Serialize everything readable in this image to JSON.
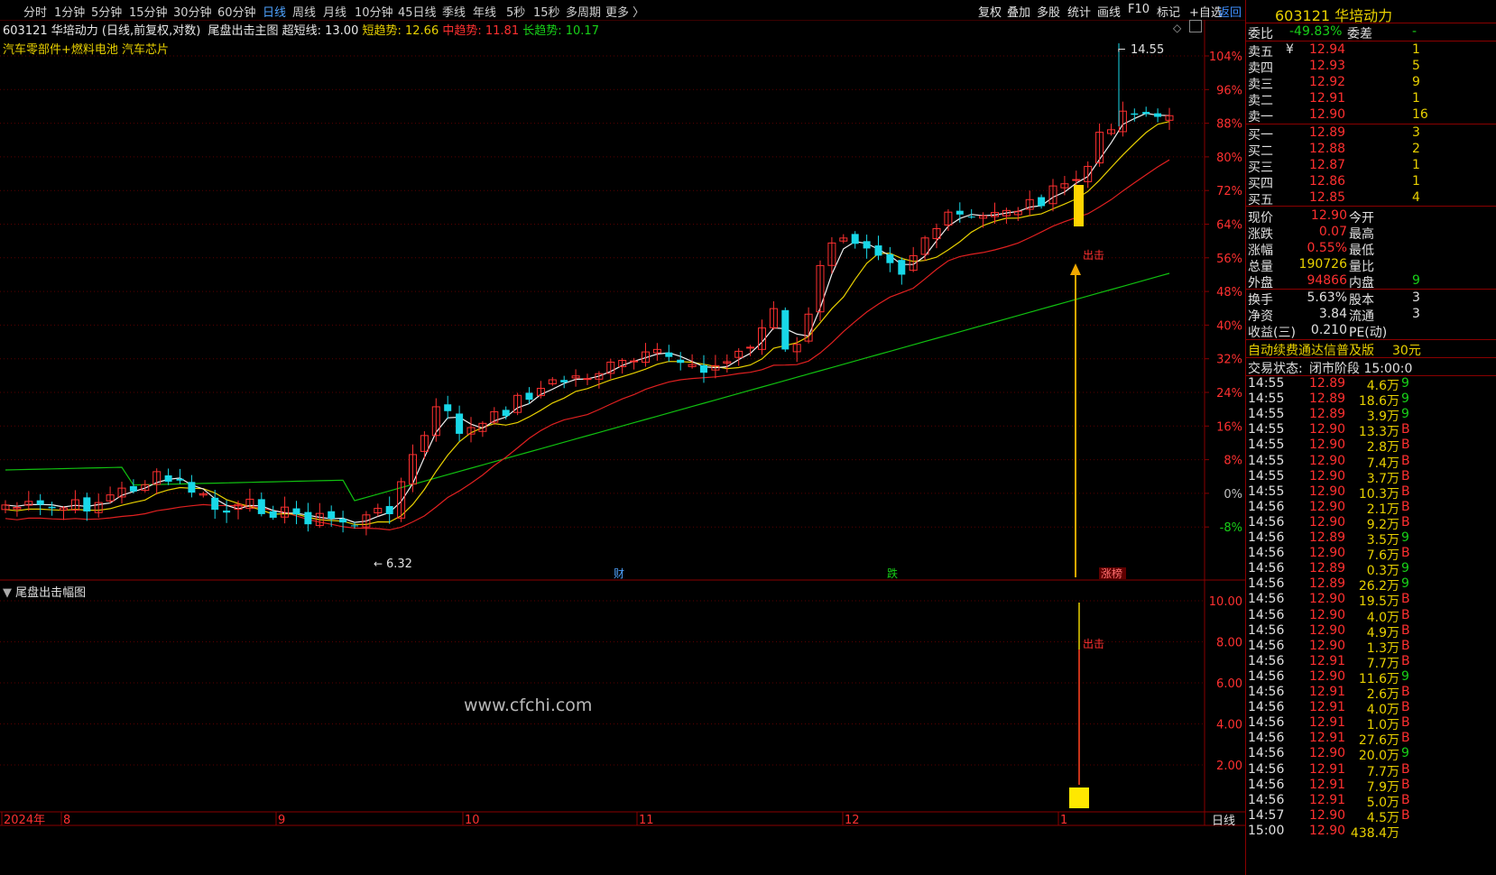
{
  "toolbar": {
    "tabs": [
      "分时",
      "1分钟",
      "5分钟",
      "15分钟",
      "30分钟",
      "60分钟",
      "日线",
      "周线",
      "月线",
      "10分钟",
      "45日线",
      "季线",
      "年线",
      "5秒",
      "15秒",
      "多周期",
      "更多 〉"
    ],
    "active_tab": "日线",
    "tools": [
      "复权",
      "叠加",
      "多股",
      "统计",
      "画线",
      "F10",
      "标记",
      "+自选"
    ],
    "back": "返回"
  },
  "chart_header": {
    "stock": "603121 华培动力",
    "mode": "(日线,前复权,对数)",
    "indicator": "尾盘出击主图",
    "ultra_label": "超短线: 13.00",
    "short_label": "短趋势: 12.66",
    "mid_label": "中趋势: 11.81",
    "long_label": "长趋势: 10.17"
  },
  "concepts": "汽车零部件+燃料电池 汽车芯片",
  "main_axis": {
    "labels": [
      "104%",
      "96%",
      "88%",
      "80%",
      "72%",
      "64%",
      "56%",
      "48%",
      "40%",
      "32%",
      "24%",
      "16%",
      "8%",
      "0%",
      "-8%"
    ],
    "high_label": "14.55",
    "low_label": "6.32",
    "signal_label": "出击"
  },
  "event_tags": [
    "财",
    "跌",
    "涨榜"
  ],
  "sub_panel": {
    "title": "尾盘出击幅图",
    "axis": [
      "10.00",
      "8.00",
      "6.00",
      "4.00",
      "2.00"
    ],
    "signal_label": "出击"
  },
  "watermark": "www.cfchi.com",
  "date_axis": [
    "2024年",
    "8",
    "9",
    "10",
    "11",
    "12",
    "1"
  ],
  "period_label": "日线",
  "quote": {
    "title": "603121 华培动力",
    "webi_label": "委比",
    "webi_value": "-49.83%",
    "weicha_label": "委差",
    "weicha_value": "-",
    "asks": [
      {
        "label": "卖五",
        "price": "12.94",
        "vol": "1",
        "mark": "¥"
      },
      {
        "label": "卖四",
        "price": "12.93",
        "vol": "5",
        "mark": ""
      },
      {
        "label": "卖三",
        "price": "12.92",
        "vol": "9",
        "mark": ""
      },
      {
        "label": "卖二",
        "price": "12.91",
        "vol": "1",
        "mark": ""
      },
      {
        "label": "卖一",
        "price": "12.90",
        "vol": "16",
        "mark": ""
      }
    ],
    "bids": [
      {
        "label": "买一",
        "price": "12.89",
        "vol": "3"
      },
      {
        "label": "买二",
        "price": "12.88",
        "vol": "2"
      },
      {
        "label": "买三",
        "price": "12.87",
        "vol": "1"
      },
      {
        "label": "买四",
        "price": "12.86",
        "vol": "1"
      },
      {
        "label": "买五",
        "price": "12.85",
        "vol": "4"
      }
    ],
    "stats": [
      {
        "l1": "现价",
        "v1": "12.90",
        "c1": "red",
        "l2": "今开",
        "v2": ""
      },
      {
        "l1": "涨跌",
        "v1": "0.07",
        "c1": "red",
        "l2": "最高",
        "v2": ""
      },
      {
        "l1": "涨幅",
        "v1": "0.55%",
        "c1": "red",
        "l2": "最低",
        "v2": ""
      },
      {
        "l1": "总量",
        "v1": "190726",
        "c1": "yellow",
        "l2": "量比",
        "v2": ""
      },
      {
        "l1": "外盘",
        "v1": "94866",
        "c1": "red",
        "l2": "内盘",
        "v2": "9"
      }
    ],
    "stats2": [
      {
        "l1": "换手",
        "v1": "5.63%",
        "l2": "股本",
        "v2": "3"
      },
      {
        "l1": "净资",
        "v1": "3.84",
        "l2": "流通",
        "v2": "3"
      },
      {
        "l1": "收益(三)",
        "v1": "0.210",
        "l2": "PE(动)",
        "v2": ""
      }
    ],
    "ad_text": "自动续费通达信普及版",
    "ad_price": "30元",
    "trade_status_label": "交易状态:",
    "trade_status": "闭市阶段 15:00:0",
    "ticks": [
      {
        "t": "14:55",
        "p": "12.89",
        "v": "4.6万",
        "d": "9"
      },
      {
        "t": "14:55",
        "p": "12.89",
        "v": "18.6万",
        "d": "9"
      },
      {
        "t": "14:55",
        "p": "12.89",
        "v": "3.9万",
        "d": "9"
      },
      {
        "t": "14:55",
        "p": "12.90",
        "v": "13.3万",
        "d": "B"
      },
      {
        "t": "14:55",
        "p": "12.90",
        "v": "2.8万",
        "d": "B"
      },
      {
        "t": "14:55",
        "p": "12.90",
        "v": "7.4万",
        "d": "B"
      },
      {
        "t": "14:55",
        "p": "12.90",
        "v": "3.7万",
        "d": "B"
      },
      {
        "t": "14:55",
        "p": "12.90",
        "v": "10.3万",
        "d": "B"
      },
      {
        "t": "14:56",
        "p": "12.90",
        "v": "2.1万",
        "d": "B"
      },
      {
        "t": "14:56",
        "p": "12.90",
        "v": "9.2万",
        "d": "B"
      },
      {
        "t": "14:56",
        "p": "12.89",
        "v": "3.5万",
        "d": "9"
      },
      {
        "t": "14:56",
        "p": "12.90",
        "v": "7.6万",
        "d": "B"
      },
      {
        "t": "14:56",
        "p": "12.89",
        "v": "0.3万",
        "d": "9"
      },
      {
        "t": "14:56",
        "p": "12.89",
        "v": "26.2万",
        "d": "9"
      },
      {
        "t": "14:56",
        "p": "12.90",
        "v": "19.5万",
        "d": "B"
      },
      {
        "t": "14:56",
        "p": "12.90",
        "v": "4.0万",
        "d": "B"
      },
      {
        "t": "14:56",
        "p": "12.90",
        "v": "4.9万",
        "d": "B"
      },
      {
        "t": "14:56",
        "p": "12.90",
        "v": "1.3万",
        "d": "B"
      },
      {
        "t": "14:56",
        "p": "12.91",
        "v": "7.7万",
        "d": "B"
      },
      {
        "t": "14:56",
        "p": "12.90",
        "v": "11.6万",
        "d": "9"
      },
      {
        "t": "14:56",
        "p": "12.91",
        "v": "2.6万",
        "d": "B"
      },
      {
        "t": "14:56",
        "p": "12.91",
        "v": "4.0万",
        "d": "B"
      },
      {
        "t": "14:56",
        "p": "12.91",
        "v": "1.0万",
        "d": "B"
      },
      {
        "t": "14:56",
        "p": "12.91",
        "v": "27.6万",
        "d": "B"
      },
      {
        "t": "14:56",
        "p": "12.90",
        "v": "20.0万",
        "d": "9"
      },
      {
        "t": "14:56",
        "p": "12.91",
        "v": "7.7万",
        "d": "B"
      },
      {
        "t": "14:56",
        "p": "12.91",
        "v": "7.9万",
        "d": "B"
      },
      {
        "t": "14:56",
        "p": "12.91",
        "v": "5.0万",
        "d": "B"
      },
      {
        "t": "14:57",
        "p": "12.90",
        "v": "4.5万",
        "d": "B"
      },
      {
        "t": "15:00",
        "p": "12.90",
        "v": "438.4万",
        "d": ""
      }
    ]
  }
}
